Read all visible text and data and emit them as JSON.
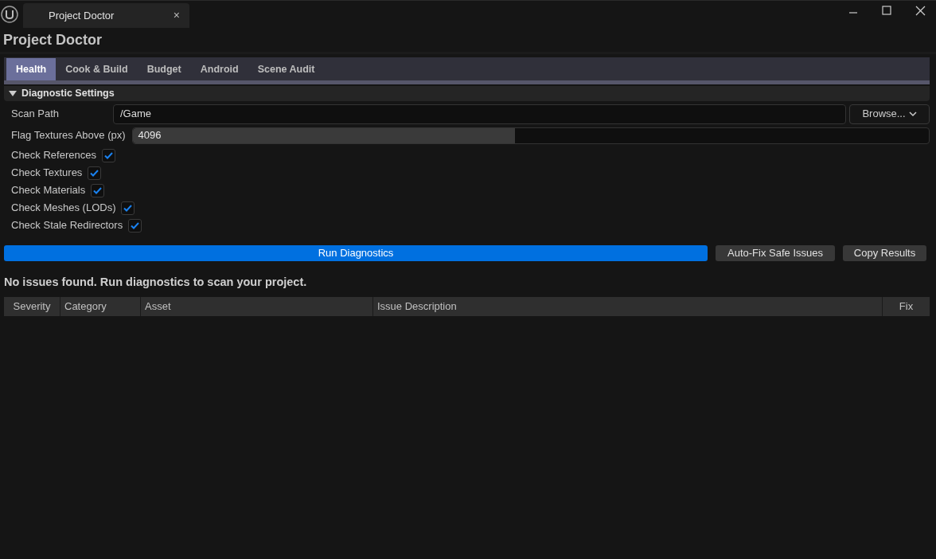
{
  "window": {
    "tab_title": "Project Doctor",
    "close_glyph": "×"
  },
  "heading": "Project Doctor",
  "tabs": [
    {
      "label": "Health",
      "selected": true
    },
    {
      "label": "Cook & Build",
      "selected": false
    },
    {
      "label": "Budget",
      "selected": false
    },
    {
      "label": "Android",
      "selected": false
    },
    {
      "label": "Scene Audit",
      "selected": false
    }
  ],
  "section": {
    "title": "Diagnostic Settings",
    "expanded": true
  },
  "scan_path": {
    "label": "Scan Path",
    "value": "/Game",
    "browse": "Browse..."
  },
  "flag_textures": {
    "label": "Flag Textures Above (px)",
    "value": "4096",
    "level": 0.48
  },
  "checks": [
    {
      "label": "Check References",
      "checked": true
    },
    {
      "label": "Check Textures",
      "checked": true
    },
    {
      "label": "Check Materials",
      "checked": true
    },
    {
      "label": "Check Meshes (LODs)",
      "checked": true
    },
    {
      "label": "Check Stale Redirectors",
      "checked": true
    }
  ],
  "actions": {
    "run": "Run Diagnostics",
    "autofix": "Auto-Fix Safe Issues",
    "copy": "Copy Results"
  },
  "status": "No issues found. Run diagnostics to scan your project.",
  "table": {
    "columns": [
      "Severity",
      "Category",
      "Asset",
      "Issue Description",
      "Fix"
    ]
  }
}
